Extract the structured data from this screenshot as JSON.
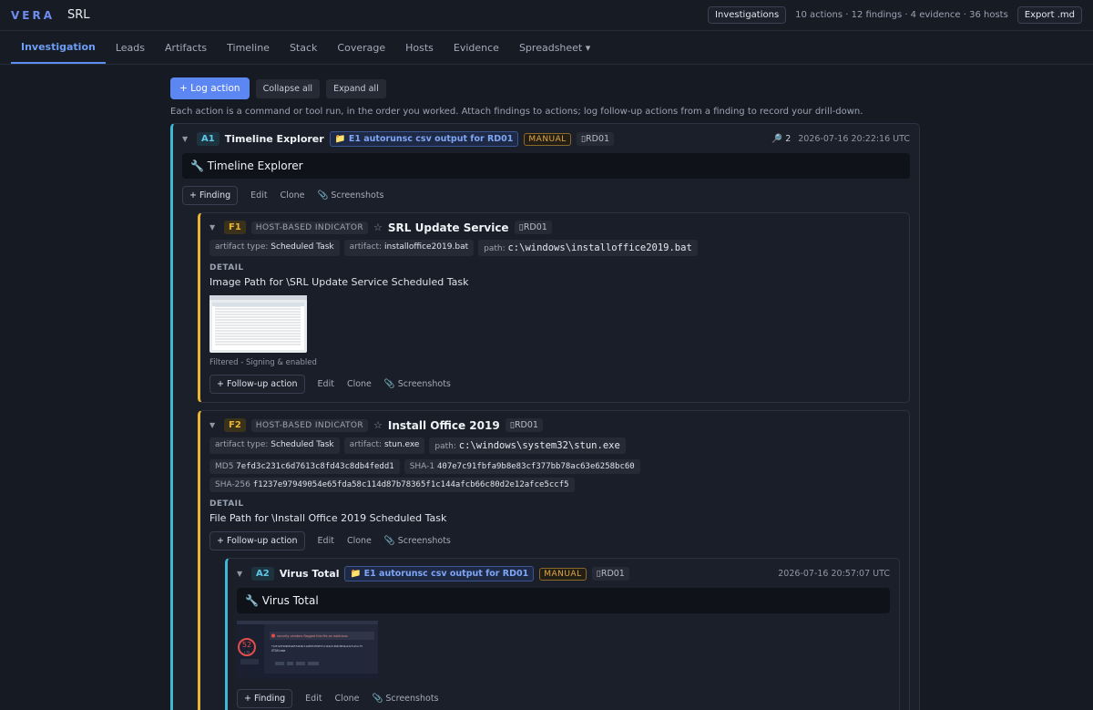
{
  "app": {
    "logo": "VERA",
    "case_name": "SRL"
  },
  "header": {
    "investigations_button": "Investigations",
    "stats": "10 actions · 12 findings · 4 evidence · 36 hosts",
    "export_button": "Export .md"
  },
  "tabs": [
    {
      "label": "Investigation",
      "active": true
    },
    {
      "label": "Leads"
    },
    {
      "label": "Artifacts"
    },
    {
      "label": "Timeline"
    },
    {
      "label": "Stack"
    },
    {
      "label": "Coverage"
    },
    {
      "label": "Hosts"
    },
    {
      "label": "Evidence"
    },
    {
      "label": "Spreadsheet ▾"
    }
  ],
  "toolbar": {
    "log_action": "+ Log action",
    "collapse_all": "Collapse all",
    "expand_all": "Expand all",
    "hint": "Each action is a command or tool run, in the order you worked. Attach findings to actions; log follow-up actions from a finding to record your drill-down."
  },
  "actions": [
    {
      "id": "A1",
      "title": "Timeline Explorer",
      "evidence": "📁 E1 autorunsc csv output for RD01",
      "mode": "MANUAL",
      "host": "RD01",
      "finding_count": "2",
      "timestamp": "2026-07-16 20:22:16 UTC",
      "command": "🔧 Timeline Explorer",
      "buttons": {
        "add": "+ Finding",
        "edit": "Edit",
        "clone": "Clone",
        "screenshots": "Screenshots"
      }
    },
    {
      "id": "A2",
      "title": "Virus Total",
      "evidence": "📁 E1 autorunsc csv output for RD01",
      "mode": "MANUAL",
      "host": "RD01",
      "timestamp": "2026-07-16 20:57:07 UTC",
      "command": "🔧 Virus Total",
      "screenshot_text": {
        "score": "52",
        "score_sub": "/ 72",
        "alert": "security vendors flagged this file as malicious",
        "hash": "f1237e97949054e65fda58c114d87b78365f1c144afcb66c80d2e12afce5ccf5",
        "file": "STUN.exe"
      },
      "buttons": {
        "add": "+ Finding",
        "edit": "Edit",
        "clone": "Clone",
        "screenshots": "Screenshots"
      }
    }
  ],
  "findings": [
    {
      "id": "F1",
      "kind": "HOST-BASED INDICATOR",
      "title": "SRL Update Service",
      "host": "RD01",
      "artifact_type_label": "artifact type:",
      "artifact_type": "Scheduled Task",
      "artifact_label": "artifact:",
      "artifact": "installoffice2019.bat",
      "path_label": "path:",
      "path": "c:\\windows\\installoffice2019.bat",
      "detail_label": "DETAIL",
      "detail": "Image Path for \\SRL Update Service Scheduled Task",
      "screenshot_caption": "Filtered - Signing & enabled",
      "buttons": {
        "follow": "+ Follow-up action",
        "edit": "Edit",
        "clone": "Clone",
        "screenshots": "Screenshots"
      }
    },
    {
      "id": "F2",
      "kind": "HOST-BASED INDICATOR",
      "title": "Install Office 2019",
      "host": "RD01",
      "artifact_type_label": "artifact type:",
      "artifact_type": "Scheduled Task",
      "artifact_label": "artifact:",
      "artifact": "stun.exe",
      "path_label": "path:",
      "path": "c:\\windows\\system32\\stun.exe",
      "md5_label": "MD5",
      "md5": "7efd3c231c6d7613c8fd43c8db4fedd1",
      "sha1_label": "SHA-1",
      "sha1": "407e7c91fbfa9b8e83cf377bb78ac63e6258bc60",
      "sha256_label": "SHA-256",
      "sha256": "f1237e97949054e65fda58c114d87b78365f1c144afcb66c80d2e12afce5ccf5",
      "detail_label": "DETAIL",
      "detail": "File Path for \\Install Office 2019 Scheduled Task",
      "buttons": {
        "follow": "+ Follow-up action",
        "edit": "Edit",
        "clone": "Clone",
        "screenshots": "Screenshots"
      }
    }
  ]
}
